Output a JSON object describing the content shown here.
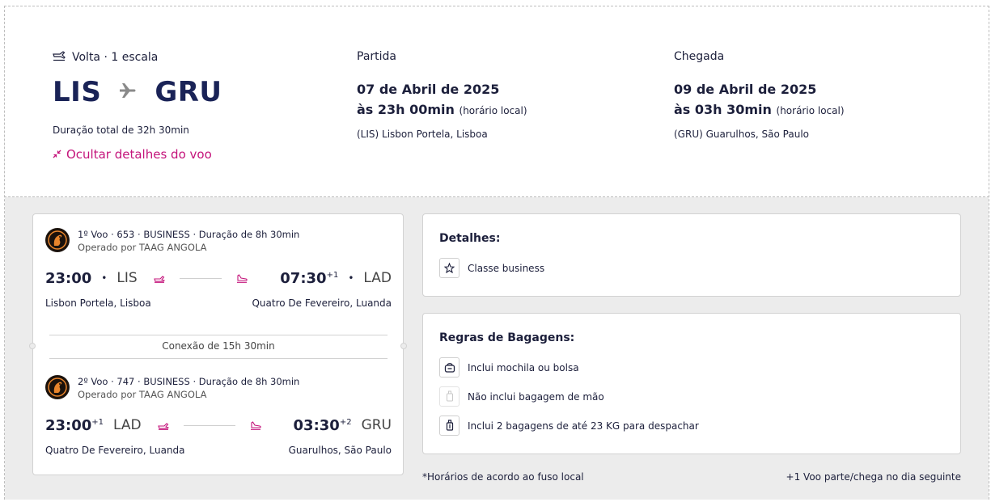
{
  "summary": {
    "direction_label": "Volta · 1 escala",
    "origin": "LIS",
    "destination": "GRU",
    "total_duration": "Duração total de 32h 30min",
    "toggle_link": "Ocultar detalhes do voo"
  },
  "departure": {
    "label": "Partida",
    "date": "07 de Abril de 2025",
    "time": "às 23h 00min",
    "time_note": "(horário local)",
    "airport": "(LIS) Lisbon Portela, Lisboa"
  },
  "arrival": {
    "label": "Chegada",
    "date": "09 de Abril de 2025",
    "time": "às 03h 30min",
    "time_note": "(horário local)",
    "airport": "(GRU) Guarulhos, São Paulo"
  },
  "legs": [
    {
      "title": "1º Voo · 653 · BUSINESS · Duração de 8h 30min",
      "operator": "Operado por TAAG ANGOLA",
      "dep_time": "23:00",
      "dep_offset": "",
      "dep_code": "LIS",
      "arr_time": "07:30",
      "arr_offset": "+1",
      "arr_code": "LAD",
      "dep_place": "Lisbon Portela, Lisboa",
      "arr_place": "Quatro De Fevereiro, Luanda"
    },
    {
      "title": "2º Voo · 747 · BUSINESS · Duração de 8h 30min",
      "operator": "Operado por TAAG ANGOLA",
      "dep_time": "23:00",
      "dep_offset": "+1",
      "dep_code": "LAD",
      "arr_time": "03:30",
      "arr_offset": "+2",
      "arr_code": "GRU",
      "dep_place": "Quatro De Fevereiro, Luanda",
      "arr_place": "Guarulhos, São Paulo"
    }
  ],
  "connection": "Conexão de 15h 30min",
  "details": {
    "title": "Detalhes:",
    "items": [
      "Classe business"
    ]
  },
  "baggage": {
    "title": "Regras de Bagagens:",
    "items": [
      "Inclui mochila ou bolsa",
      "Não inclui bagagem de mão",
      "Inclui 2 bagagens de até 23 KG para despachar"
    ]
  },
  "footnotes": {
    "left": "*Horários de acordo ao fuso local",
    "right": "+1 Voo parte/chega no dia seguinte"
  },
  "colors": {
    "navy": "#1a2357",
    "accent_pink": "#c4147b",
    "panel_gray": "#ececec"
  },
  "icons": [
    "return-flight-icon",
    "plane-icon",
    "collapse-icon",
    "airline-logo-icon",
    "takeoff-icon",
    "landing-icon",
    "star-icon",
    "backpack-icon",
    "hand-luggage-icon",
    "checked-bag-icon"
  ]
}
